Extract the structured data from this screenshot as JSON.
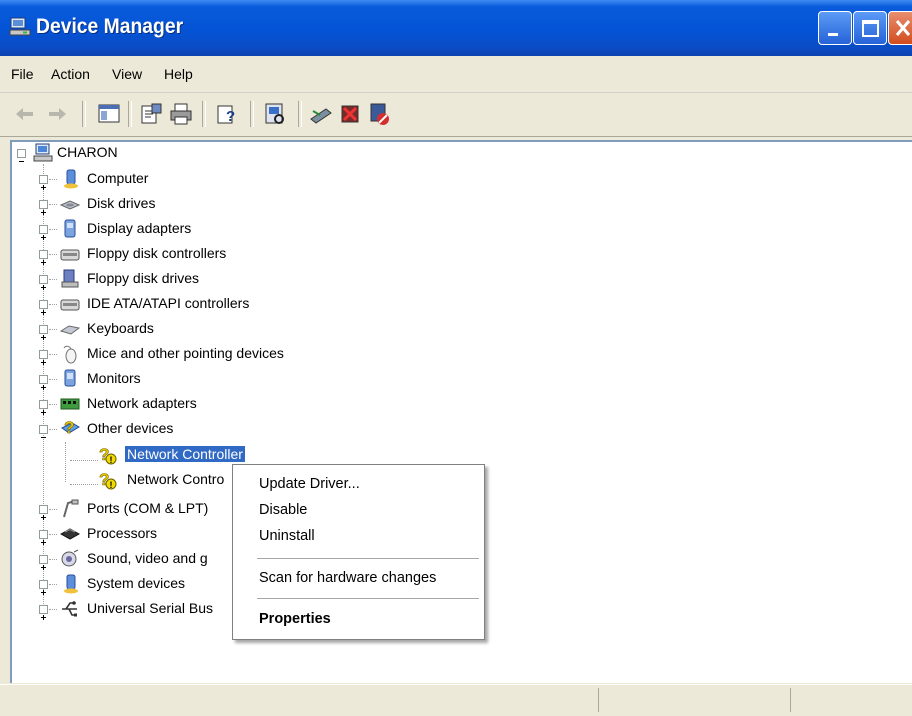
{
  "window": {
    "title": "Device Manager"
  },
  "menubar": {
    "items": [
      "File",
      "Action",
      "View",
      "Help"
    ]
  },
  "toolbar": {
    "buttons": [
      "back-icon",
      "forward-icon",
      "show-hide-console-tree-icon",
      "properties-icon",
      "print-icon",
      "help-icon",
      "scan-hardware-icon",
      "update-driver-icon",
      "uninstall-icon",
      "disable-icon"
    ]
  },
  "tree": {
    "root": "CHARON",
    "items": [
      {
        "label": "Computer",
        "icon": "computer-icon"
      },
      {
        "label": "Disk drives",
        "icon": "disk-drive-icon"
      },
      {
        "label": "Display adapters",
        "icon": "display-adapter-icon"
      },
      {
        "label": "Floppy disk controllers",
        "icon": "controller-icon"
      },
      {
        "label": "Floppy disk drives",
        "icon": "floppy-drive-icon"
      },
      {
        "label": "IDE ATA/ATAPI controllers",
        "icon": "controller-icon"
      },
      {
        "label": "Keyboards",
        "icon": "keyboard-icon"
      },
      {
        "label": "Mice and other pointing devices",
        "icon": "mouse-icon"
      },
      {
        "label": "Monitors",
        "icon": "monitor-icon"
      },
      {
        "label": "Network adapters",
        "icon": "network-adapter-icon"
      },
      {
        "label": "Other devices",
        "icon": "unknown-device-icon",
        "children": [
          {
            "label": "Network Controller",
            "selected": true
          },
          {
            "label": "Network Contro"
          }
        ]
      },
      {
        "label": "Ports (COM & LPT)",
        "icon": "port-icon"
      },
      {
        "label": "Processors",
        "icon": "processor-icon"
      },
      {
        "label": "Sound, video and g",
        "icon": "sound-icon"
      },
      {
        "label": "System devices",
        "icon": "system-device-icon"
      },
      {
        "label": "Universal Serial Bus",
        "icon": "usb-icon"
      }
    ]
  },
  "context_menu": {
    "update_driver": "Update Driver...",
    "disable": "Disable",
    "uninstall": "Uninstall",
    "scan": "Scan for hardware changes",
    "properties": "Properties"
  },
  "colors": {
    "title_bar": "#0453d6",
    "selection": "#316ac5",
    "face": "#ece9d8"
  }
}
